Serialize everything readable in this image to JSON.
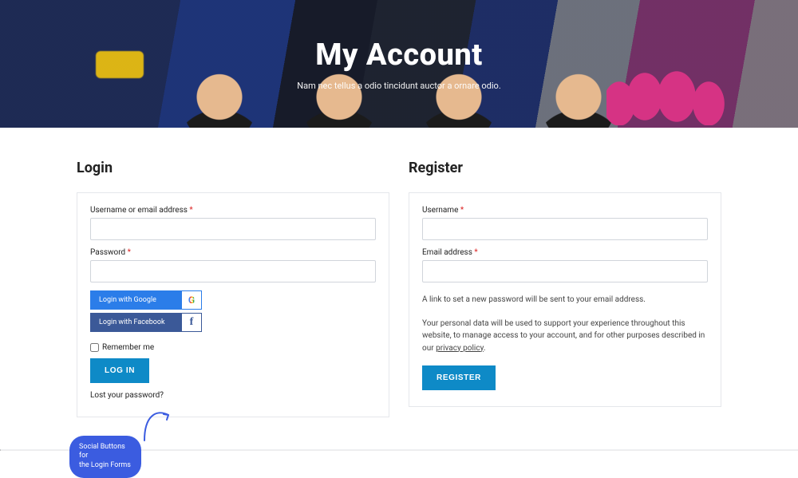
{
  "hero": {
    "title": "My Account",
    "subtitle": "Nam nec tellus a odio tincidunt auctor a ornare odio."
  },
  "popover": {
    "text_l1": "Social Buttons for",
    "text_l2": "the Login Forms"
  },
  "login": {
    "heading": "Login",
    "username_label": "Username or email address",
    "password_label": "Password",
    "required": "*",
    "google_btn": "Login with Google",
    "facebook_btn": "Login with Facebook",
    "remember": "Remember me",
    "submit": "LOG IN",
    "lost_pwd": "Lost your password?"
  },
  "register": {
    "heading": "Register",
    "username_label": "Username",
    "email_label": "Email address",
    "required": "*",
    "note_link": "A link to set a new password will be sent to your email address.",
    "privacy_text": "Your personal data will be used to support your experience throughout this website, to manage access to your account, and for other purposes described in our ",
    "privacy_link": "privacy policy",
    "privacy_tail": ".",
    "submit": "REGISTER"
  },
  "icons": {
    "google_glyph": "G",
    "facebook_glyph": "f"
  }
}
